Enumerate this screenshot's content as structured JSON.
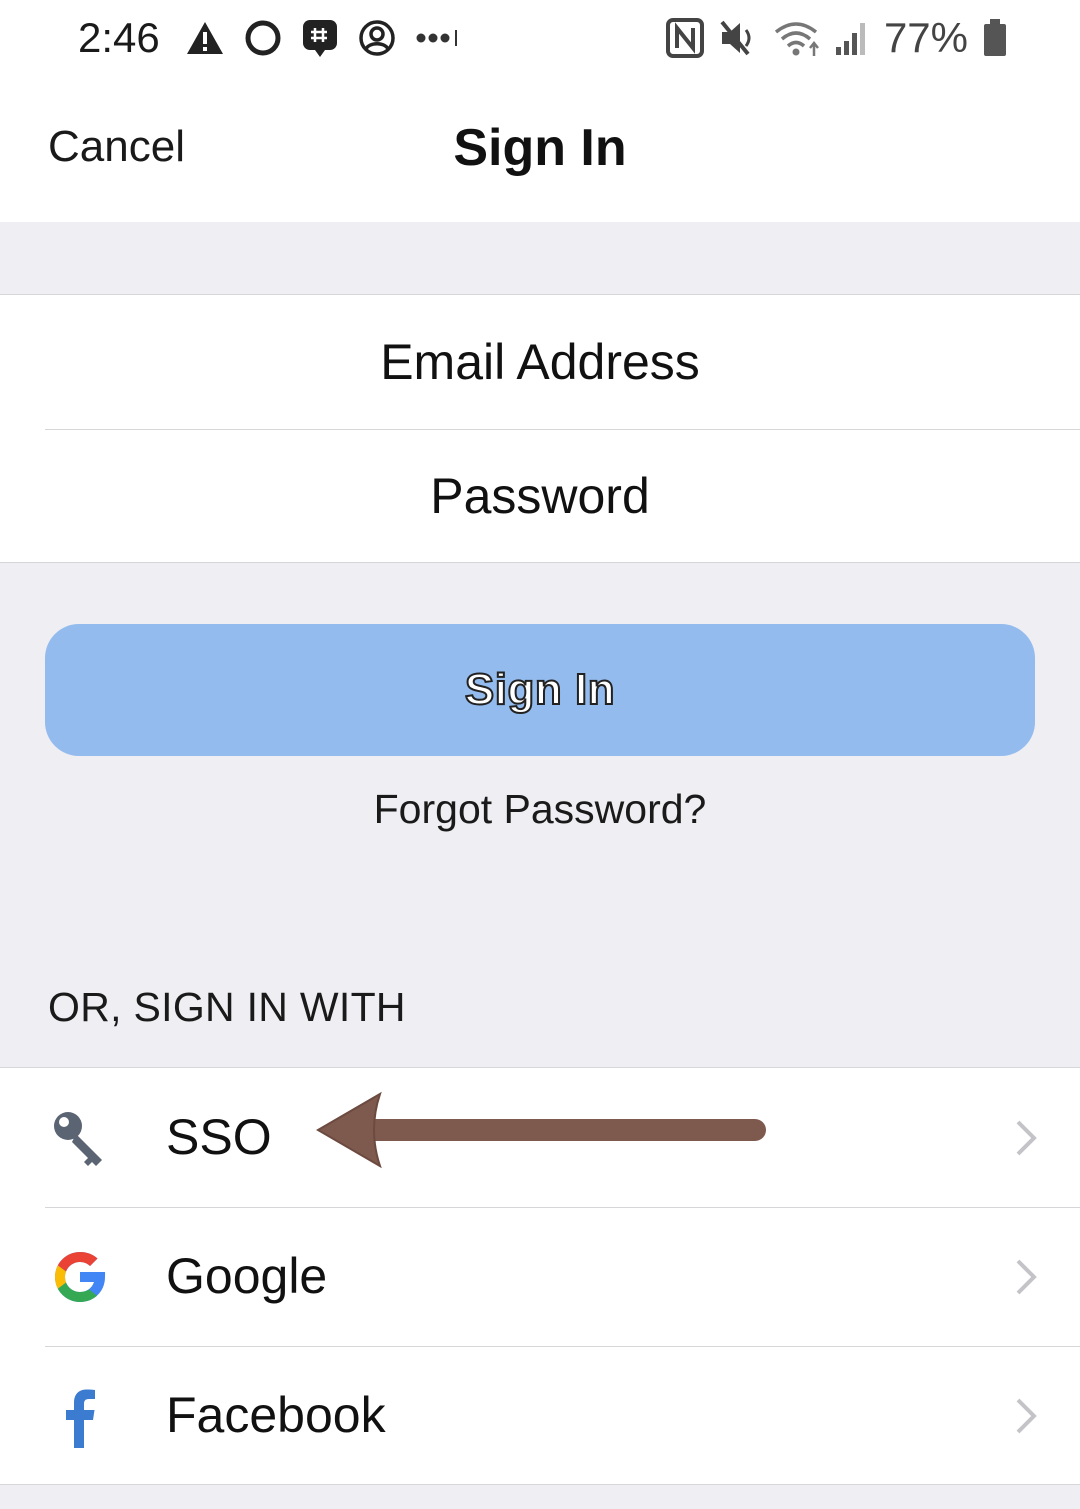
{
  "status_bar": {
    "time": "2:46",
    "battery": "77%",
    "left_icons": [
      "warning-icon",
      "ring-icon",
      "hashtag-chat-icon",
      "account-circle-icon",
      "more-dots-icon"
    ],
    "right_icons": [
      "nfc-icon",
      "mute-icon",
      "wifi-icon",
      "signal-icon",
      "battery-icon"
    ]
  },
  "nav": {
    "cancel_label": "Cancel",
    "title": "Sign In"
  },
  "form": {
    "email_placeholder": "Email Address",
    "password_placeholder": "Password"
  },
  "signin_button": {
    "label": "Sign In",
    "color": "#93bbee"
  },
  "forgot_password": "Forgot Password?",
  "alt_signin": {
    "heading": "OR, SIGN IN WITH",
    "providers": [
      {
        "label": "SSO",
        "icon": "key-icon"
      },
      {
        "label": "Google",
        "icon": "google-logo-icon"
      },
      {
        "label": "Facebook",
        "icon": "facebook-logo-icon"
      }
    ]
  },
  "annotation": {
    "arrow_color": "#7e5a4e"
  }
}
